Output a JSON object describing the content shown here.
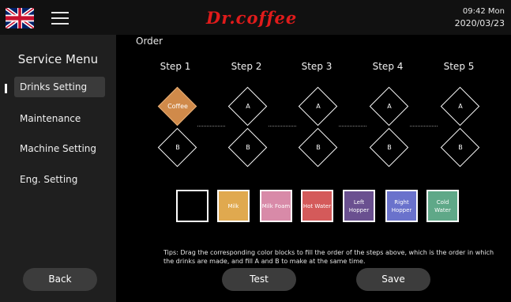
{
  "header": {
    "brand": "Dr.coffee",
    "time": "09:42 Mon",
    "date": "2020/03/23",
    "flag": "uk-flag-icon",
    "menu_icon": "hamburger-icon"
  },
  "sidebar": {
    "title": "Service Menu",
    "items": [
      {
        "label": "Drinks Setting",
        "active": true
      },
      {
        "label": "Maintenance"
      },
      {
        "label": "Machine Setting"
      },
      {
        "label": "Eng. Setting"
      }
    ],
    "back_label": "Back"
  },
  "main": {
    "order_label": "Order",
    "steps": [
      "Step 1",
      "Step 2",
      "Step 3",
      "Step 4",
      "Step 5"
    ],
    "row_a": [
      "Coffee",
      "A",
      "A",
      "A",
      "A"
    ],
    "row_b": [
      "B",
      "B",
      "B",
      "B",
      "B"
    ],
    "swatches": [
      {
        "label": "",
        "color": "#000000"
      },
      {
        "label": "Milk",
        "color": "#e0a94f"
      },
      {
        "label": "Milk Foam",
        "color": "#d88aa8"
      },
      {
        "label": "Hot Water",
        "color": "#d45a5a"
      },
      {
        "label": "Left Hopper",
        "color": "#6a5090"
      },
      {
        "label": "Right Hopper",
        "color": "#6a72cc"
      },
      {
        "label": "Cold Water",
        "color": "#5fa888"
      }
    ],
    "tips": "Tips: Drag the corresponding color blocks to fill the order of the steps above, which is the order in which the drinks are made, and fill A and B to make at the same time.",
    "test_label": "Test",
    "save_label": "Save"
  },
  "colors": {
    "brand": "#e01b1b",
    "coffee": "#d08a4a",
    "sidebar_bg": "#1f1f1f"
  }
}
